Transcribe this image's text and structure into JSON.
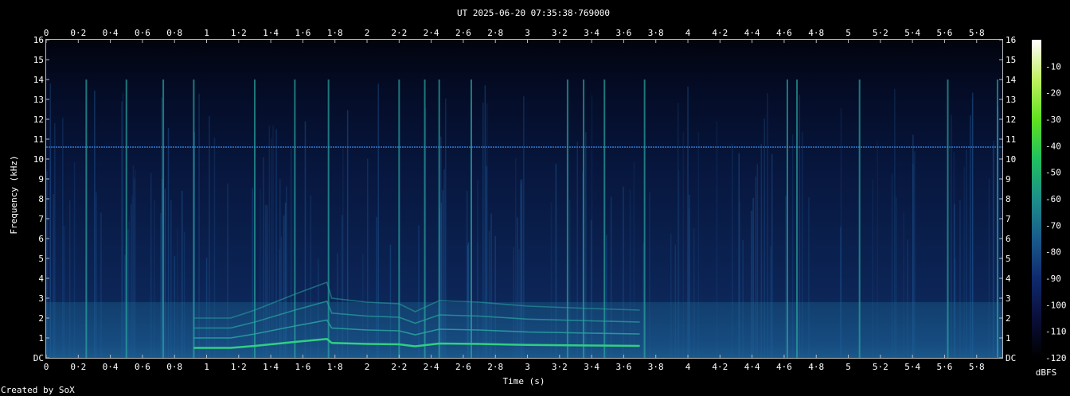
{
  "chart_data": {
    "type": "heatmap",
    "title": "UT 2025-06-20 07:35:38·769000",
    "xlabel": "Time (s)",
    "ylabel": "Frequency (kHz)",
    "xlim": [
      0,
      5.96
    ],
    "ylim": [
      0,
      16
    ],
    "x_ticks": [
      "0",
      "0·2",
      "0·4",
      "0·6",
      "0·8",
      "1",
      "1·2",
      "1·4",
      "1·6",
      "1·8",
      "2",
      "2·2",
      "2·4",
      "2·6",
      "2·8",
      "3",
      "3·2",
      "3·4",
      "3·6",
      "3·8",
      "4",
      "4·2",
      "4·4",
      "4·6",
      "4·8",
      "5",
      "5·2",
      "5·4",
      "5·6",
      "5·8"
    ],
    "x_tick_values": [
      0,
      0.2,
      0.4,
      0.6,
      0.8,
      1,
      1.2,
      1.4,
      1.6,
      1.8,
      2,
      2.2,
      2.4,
      2.6,
      2.8,
      3,
      3.2,
      3.4,
      3.6,
      3.8,
      4,
      4.2,
      4.4,
      4.6,
      4.8,
      5,
      5.2,
      5.4,
      5.6,
      5.8
    ],
    "y_ticks": [
      "DC",
      "1",
      "2",
      "3",
      "4",
      "5",
      "6",
      "7",
      "8",
      "9",
      "10",
      "11",
      "12",
      "13",
      "14",
      "15",
      "16"
    ],
    "y_tick_values": [
      0,
      1,
      2,
      3,
      4,
      5,
      6,
      7,
      8,
      9,
      10,
      11,
      12,
      13,
      14,
      15,
      16
    ],
    "colorbar": {
      "label": "dBFS",
      "ticks": [
        "-10",
        "-20",
        "-30",
        "-40",
        "-50",
        "-60",
        "-70",
        "-80",
        "-90",
        "-100",
        "-110",
        "-120"
      ],
      "tick_values": [
        -10,
        -20,
        -30,
        -40,
        -50,
        -60,
        -70,
        -80,
        -90,
        -100,
        -110,
        -120
      ],
      "range": [
        -120,
        0
      ],
      "stops": [
        "#000000",
        "#0a0f3a",
        "#102a6e",
        "#1a5b8c",
        "#1d8f8a",
        "#20c060",
        "#60e020",
        "#c0f060",
        "#ffffff"
      ]
    },
    "features": {
      "tone_khz": 10.6,
      "harmonic_tracks": [
        {
          "t": [
            0.92,
            1.15,
            1.3,
            1.55,
            1.75,
            1.78,
            2.0,
            2.2,
            2.3,
            2.45,
            2.7,
            3.0,
            3.4,
            3.7
          ],
          "f": [
            0.5,
            0.5,
            0.6,
            0.8,
            0.95,
            0.75,
            0.7,
            0.68,
            0.58,
            0.72,
            0.7,
            0.65,
            0.62,
            0.6
          ]
        }
      ],
      "transients_s": [
        0.25,
        0.5,
        0.73,
        0.92,
        1.3,
        1.55,
        1.76,
        2.2,
        2.36,
        2.45,
        2.65,
        3.25,
        3.35,
        3.48,
        3.73,
        4.62,
        4.68,
        5.07,
        5.62,
        5.93
      ]
    }
  },
  "footer": {
    "credit": "Created by SoX"
  }
}
